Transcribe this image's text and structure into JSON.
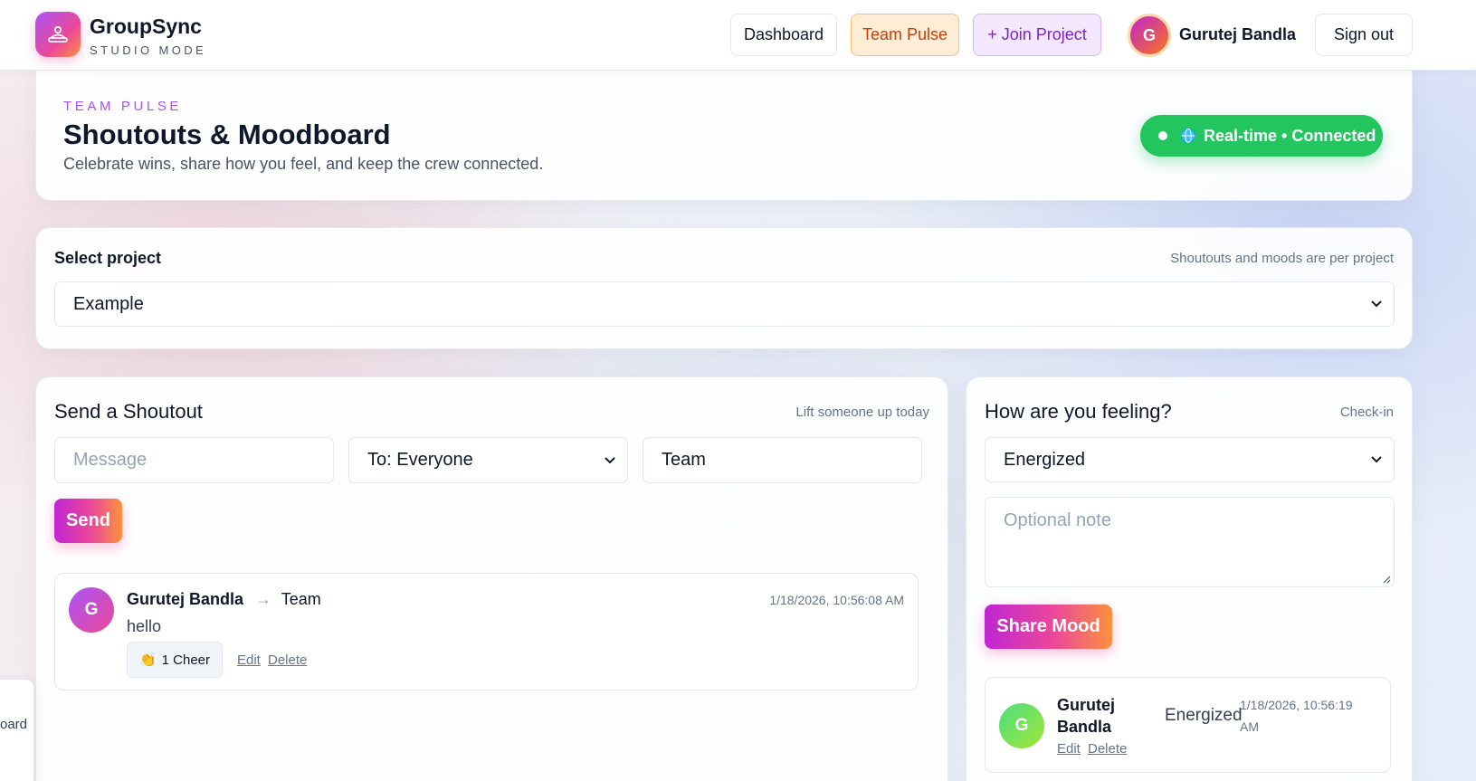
{
  "brand": {
    "name": "GroupSync",
    "subtitle": "STUDIO MODE",
    "logo_icon": "group-icon"
  },
  "nav": {
    "dashboard": "Dashboard",
    "team_pulse": "Team Pulse",
    "join_project": "+ Join Project",
    "sign_out": "Sign out"
  },
  "user": {
    "initial": "G",
    "name": "Gurutej Bandla"
  },
  "hero": {
    "eyebrow": "TEAM PULSE",
    "title": "Shoutouts & Moodboard",
    "description": "Celebrate wins, share how you feel, and keep the crew connected.",
    "status": "Real-time • Connected",
    "status_color": "#22c55e"
  },
  "project_select": {
    "label": "Select project",
    "hint": "Shoutouts and moods are per project",
    "value": "Example"
  },
  "shoutout": {
    "title": "Send a Shoutout",
    "hint": "Lift someone up today",
    "message_placeholder": "Message",
    "to_value": "To: Everyone",
    "team_value": "Team",
    "send_label": "Send",
    "posts": [
      {
        "initial": "G",
        "author": "Gurutej Bandla",
        "arrow": "→",
        "target": "Team",
        "timestamp": "1/18/2026, 10:56:08 AM",
        "message": "hello",
        "cheer_label": "1 Cheer",
        "edit": "Edit",
        "delete": "Delete"
      }
    ]
  },
  "mood": {
    "title": "How are you feeling?",
    "hint": "Check-in",
    "mood_value": "Energized",
    "note_placeholder": "Optional note",
    "share_label": "Share Mood",
    "entries": [
      {
        "initial": "G",
        "author_line1": "Gurutej",
        "author_line2": "Bandla",
        "mood": "Energized",
        "timestamp_line1": "1/18/2026, 10:56:19",
        "timestamp_line2": "AM",
        "edit": "Edit",
        "delete": "Delete"
      }
    ]
  },
  "edge_tab": {
    "text": "oard"
  },
  "colors": {
    "accent_purple": "#a855f7",
    "accent_pink": "#ec4899",
    "accent_orange": "#fb923c",
    "success": "#22c55e"
  }
}
